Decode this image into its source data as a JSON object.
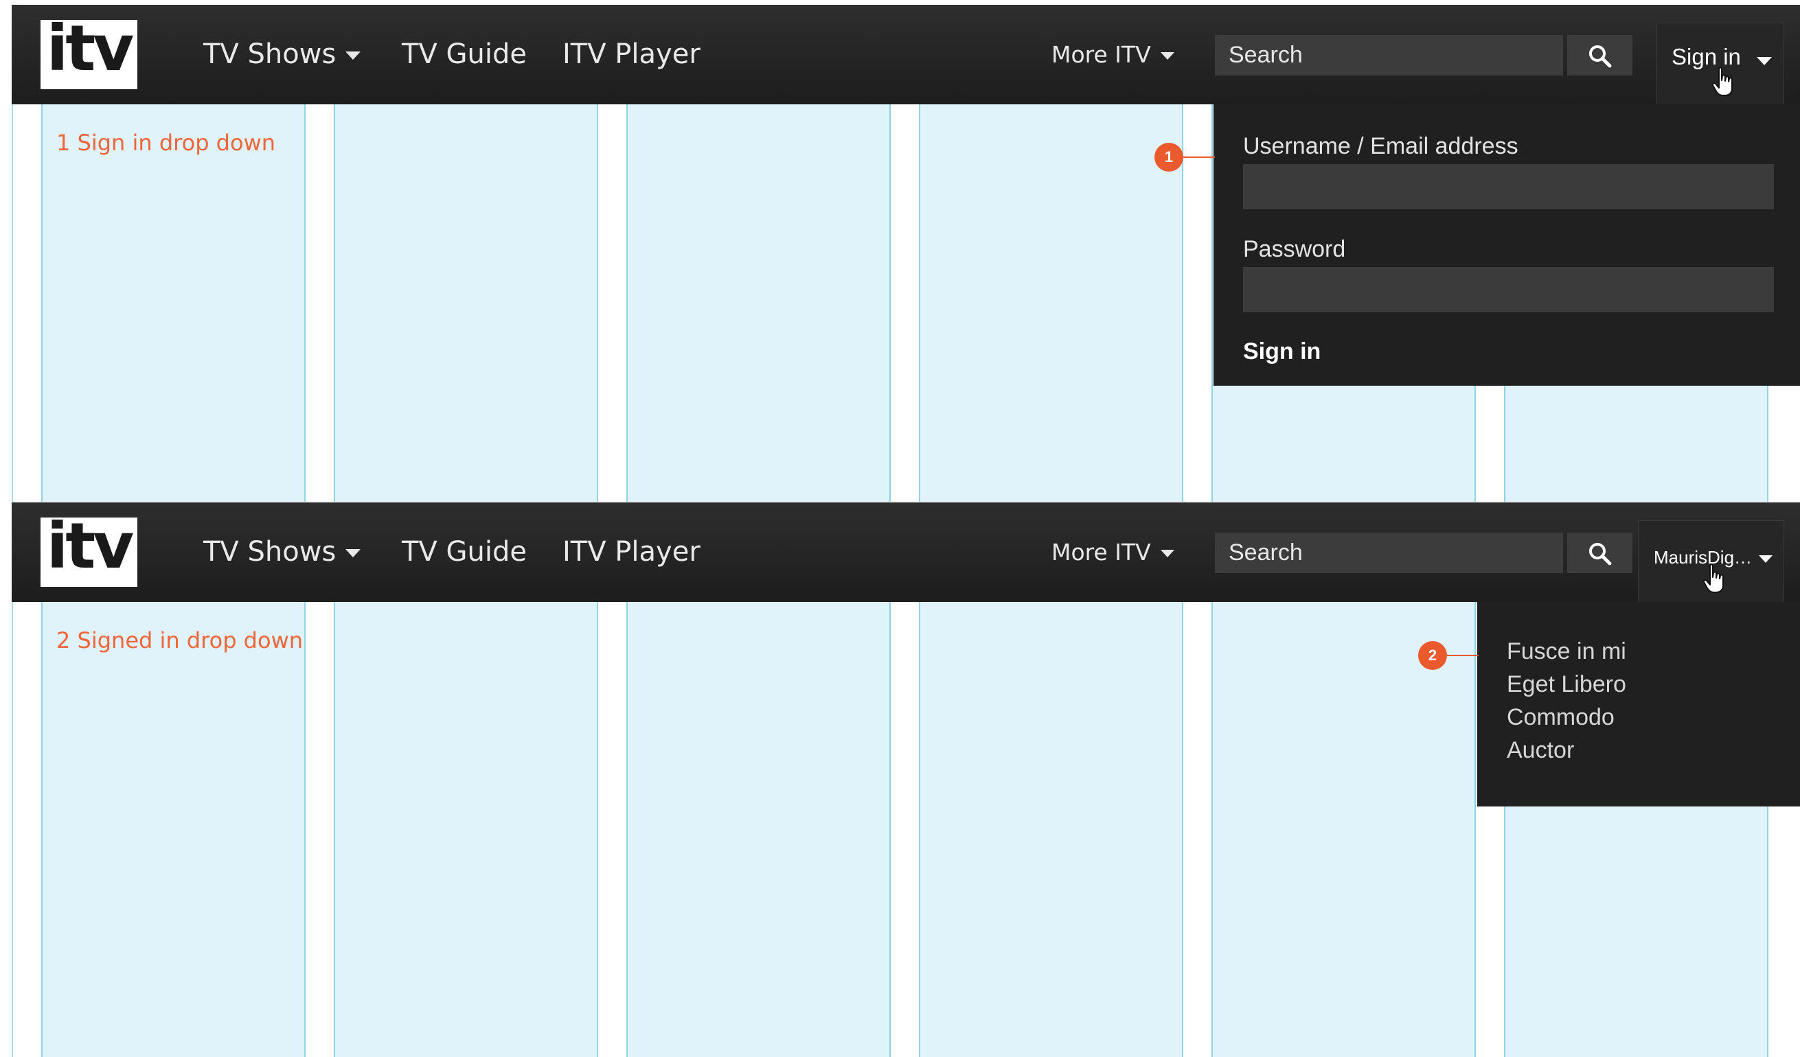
{
  "header": {
    "logo": "itv",
    "nav": [
      {
        "label": "TV Shows"
      },
      {
        "label": "TV Guide"
      },
      {
        "label": "ITV Player"
      }
    ],
    "more_label": "More ITV",
    "search_placeholder": "Search"
  },
  "panels": [
    {
      "annotation_number": "1",
      "annotation_title": "Sign in drop down",
      "account_label": "Sign in",
      "signin_form": {
        "username_label": "Username / Email address",
        "username_value": "",
        "password_label": "Password",
        "password_value": "",
        "submit_label": "Sign in"
      }
    },
    {
      "annotation_number": "2",
      "annotation_title": "Signed in drop down",
      "account_label": "MaurisDig…",
      "menu_items": [
        "Fusce in mi",
        "Eget Libero",
        "Commodo",
        "Auctor"
      ]
    }
  ],
  "colors": {
    "header_bg": "#1f1f1f",
    "grid_column": "#e0f2fa",
    "annotation": "#f0663a",
    "callout": "#ea5a2c",
    "dropdown_bg": "#202020"
  },
  "icons": [
    "search-icon",
    "caret-down-icon",
    "hand-pointer-icon"
  ]
}
